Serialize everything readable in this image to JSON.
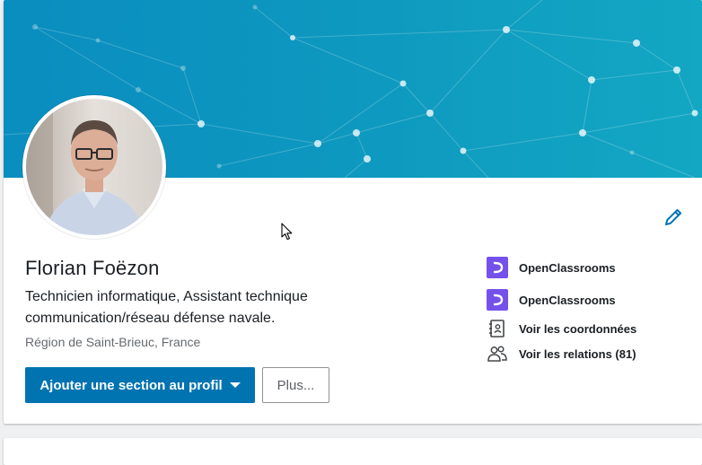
{
  "profile": {
    "name": "Florian Foëzon",
    "headline": "Technicien informatique, Assistant technique communication/réseau défense navale.",
    "location": "Région de Saint-Brieuc, France"
  },
  "actions": {
    "add_section_label": "Ajouter une section au profil",
    "more_label": "Plus..."
  },
  "sidebar": {
    "items": [
      {
        "label": "OpenClassrooms",
        "icon": "openclassrooms-logo"
      },
      {
        "label": "OpenClassrooms",
        "icon": "openclassrooms-logo"
      },
      {
        "label": "Voir les coordonnées",
        "icon": "contact-book-icon"
      },
      {
        "label": "Voir les relations (81)",
        "icon": "people-icon"
      }
    ]
  },
  "colors": {
    "primary": "#0073b1",
    "banner": "#0a8dbf",
    "openclassrooms": "#7451eb"
  }
}
